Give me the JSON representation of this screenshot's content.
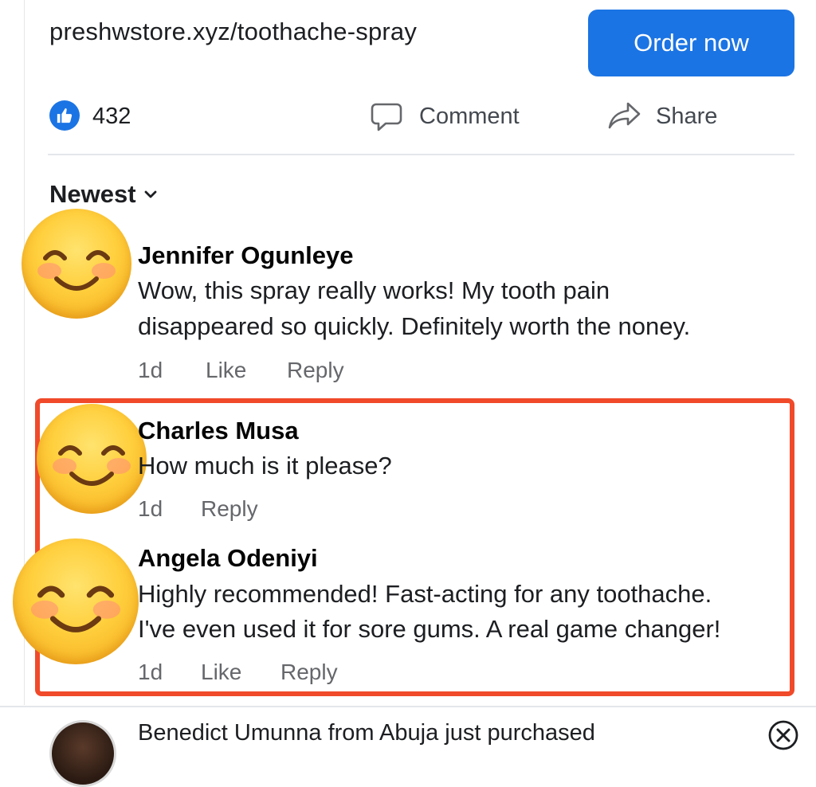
{
  "post": {
    "link_text": "preshwstore.xyz/toothache-spray",
    "order_button": "Order now"
  },
  "actions": {
    "like_count": "432",
    "comment_label": "Comment",
    "share_label": "Share"
  },
  "sort": {
    "label": "Newest"
  },
  "comments": [
    {
      "name": "Jennifer Ogunleye",
      "lines": [
        "Wow, this spray really works! My tooth pain",
        "disappeared so quickly. Definitely worth the noney."
      ],
      "time": "1d",
      "like": "Like",
      "reply": "Reply"
    },
    {
      "name": "Charles Musa",
      "lines": [
        "How much is it please?"
      ],
      "time": "1d",
      "reply": "Reply"
    },
    {
      "name": "Angela Odeniyi",
      "lines": [
        "Highly recommended! Fast-acting for any toothache.",
        "I've even used it for sore gums. A real game changer!"
      ],
      "time": "1d",
      "like": "Like",
      "reply": "Reply"
    }
  ],
  "notification": {
    "text": "Benedict Umunna from Abuja just purchased"
  },
  "colors": {
    "accent": "#1b74e4",
    "highlight_border": "#f04a2a"
  }
}
